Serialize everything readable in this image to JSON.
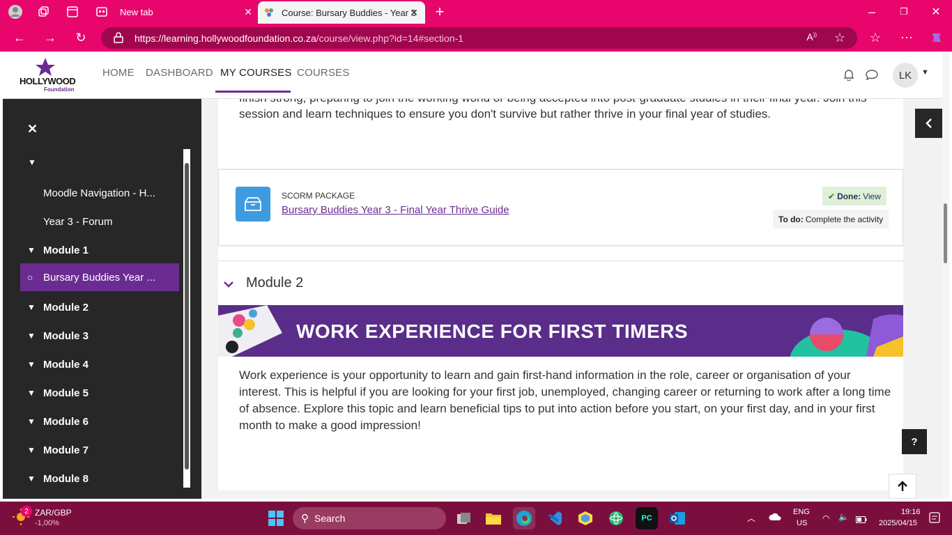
{
  "browser": {
    "tabs": [
      {
        "label": "New tab"
      },
      {
        "label": "Course: Bursary Buddies - Year 3"
      }
    ],
    "url_host": "https://learning.hollywoodfoundation.co.za",
    "url_path": "/course/view.php?id=14#section-1"
  },
  "nav": {
    "logo_text": "HOLLYWOOD",
    "logo_sub": "Foundation",
    "links": [
      "HOME",
      "DASHBOARD",
      "MY COURSES",
      "COURSES"
    ],
    "active_link": "MY COURSES",
    "avatar_initials": "LK"
  },
  "sidebar": {
    "items": [
      {
        "label": "Moodle Navigation - H...",
        "type": "activity"
      },
      {
        "label": "Year 3 - Forum",
        "type": "activity"
      },
      {
        "label": "Module 1",
        "type": "section"
      },
      {
        "label": "Bursary Buddies Year ...",
        "type": "current"
      },
      {
        "label": "Module 2",
        "type": "section"
      },
      {
        "label": "Module 3",
        "type": "section"
      },
      {
        "label": "Module 4",
        "type": "section"
      },
      {
        "label": "Module 5",
        "type": "section"
      },
      {
        "label": "Module 6",
        "type": "section"
      },
      {
        "label": "Module 7",
        "type": "section"
      },
      {
        "label": "Module 8",
        "type": "section"
      }
    ]
  },
  "main": {
    "intro_text_1": "finish strong, preparing to join the working world or being accepted into post-graduate studies in their final year. Join this",
    "intro_text_2": "session and learn techniques to ensure you don't survive but rather thrive in your final year of studies.",
    "activity": {
      "type_label": "SCORM PACKAGE",
      "name": "Bursary Buddies Year 3 - Final Year Thrive Guide",
      "done_label": "Done:",
      "done_value": "View",
      "todo_label": "To do:",
      "todo_value": "Complete the activity"
    },
    "section_title": "Module 2",
    "banner_text": "WORK EXPERIENCE FOR FIRST TIMERS",
    "section_text_1": "Work experience is your opportunity to learn and gain first-hand information in the role, career or organisation of your",
    "section_text_2": "interest. This is helpful if you are looking for your first job, unemployed, changing career or returning to work after a long time",
    "section_text_3": "of absence. Explore this topic and learn beneficial tips to put into action before you start, on your first day, and in your first",
    "section_text_4": "month to make a good impression!"
  },
  "taskbar": {
    "currency_label": "ZAR/GBP",
    "currency_change": "-1,00%",
    "badge_count": "2",
    "search_placeholder": "Search",
    "lang_1": "ENG",
    "lang_2": "US",
    "time": "19:16",
    "date": "2025/04/15"
  },
  "colors": {
    "browser_accent": "#e8066c",
    "brand_purple": "#6a2c91",
    "done_green": "#dff0d8"
  }
}
